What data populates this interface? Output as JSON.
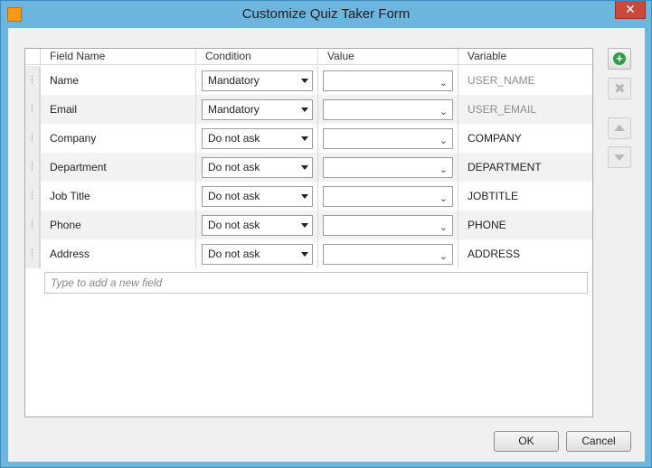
{
  "window": {
    "title": "Customize Quiz Taker Form",
    "close_glyph": "✕"
  },
  "table": {
    "headers": {
      "field_name": "Field Name",
      "condition": "Condition",
      "value": "Value",
      "variable": "Variable"
    },
    "rows": [
      {
        "field": "Name",
        "condition": "Mandatory",
        "value": "",
        "variable": "USER_NAME",
        "variable_dim": true
      },
      {
        "field": "Email",
        "condition": "Mandatory",
        "value": "",
        "variable": "USER_EMAIL",
        "variable_dim": true
      },
      {
        "field": "Company",
        "condition": "Do not ask",
        "value": "",
        "variable": "COMPANY",
        "variable_dim": false
      },
      {
        "field": "Department",
        "condition": "Do not ask",
        "value": "",
        "variable": "DEPARTMENT",
        "variable_dim": false
      },
      {
        "field": "Job Title",
        "condition": "Do not ask",
        "value": "",
        "variable": "JOBTITLE",
        "variable_dim": false
      },
      {
        "field": "Phone",
        "condition": "Do not ask",
        "value": "",
        "variable": "PHONE",
        "variable_dim": false
      },
      {
        "field": "Address",
        "condition": "Do not ask",
        "value": "",
        "variable": "ADDRESS",
        "variable_dim": false
      }
    ],
    "drag_glyph": "⋮",
    "new_field_placeholder": "Type to add a new field"
  },
  "side_buttons": {
    "add_icon": "plus-circle-icon",
    "add_glyph": "+",
    "delete_icon": "delete-x-icon",
    "delete_glyph": "✖",
    "move_up_icon": "arrow-up-icon",
    "move_down_icon": "arrow-down-icon"
  },
  "footer": {
    "ok_label": "OK",
    "cancel_label": "Cancel"
  },
  "colors": {
    "title_bar": "#6cb5df",
    "close_button": "#c74a3c",
    "add_icon": "#2ea043",
    "dim_variable": "#8c8c8c"
  }
}
